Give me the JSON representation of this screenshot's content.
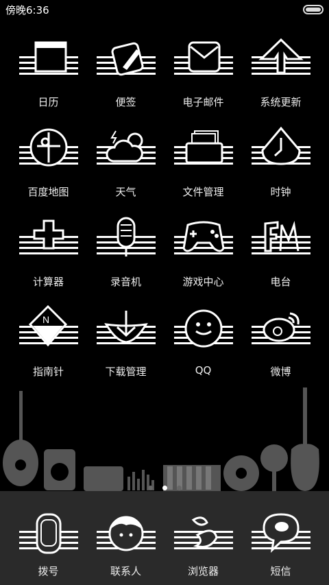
{
  "status": {
    "time": "傍晚6:36"
  },
  "apps": [
    {
      "label": "日历",
      "icon": "calendar-icon"
    },
    {
      "label": "便签",
      "icon": "notes-icon"
    },
    {
      "label": "电子邮件",
      "icon": "email-icon"
    },
    {
      "label": "系统更新",
      "icon": "system-update-icon"
    },
    {
      "label": "百度地图",
      "icon": "map-icon"
    },
    {
      "label": "天气",
      "icon": "weather-icon"
    },
    {
      "label": "文件管理",
      "icon": "file-manager-icon"
    },
    {
      "label": "时钟",
      "icon": "clock-icon"
    },
    {
      "label": "计算器",
      "icon": "calculator-icon"
    },
    {
      "label": "录音机",
      "icon": "recorder-icon"
    },
    {
      "label": "游戏中心",
      "icon": "gamepad-icon"
    },
    {
      "label": "电台",
      "icon": "radio-icon"
    },
    {
      "label": "指南针",
      "icon": "compass-icon"
    },
    {
      "label": "下载管理",
      "icon": "download-icon"
    },
    {
      "label": "QQ",
      "icon": "qq-penguin-icon"
    },
    {
      "label": "微博",
      "icon": "weibo-icon"
    }
  ],
  "pager": {
    "pages": 3,
    "current": 2
  },
  "dock": [
    {
      "label": "拨号",
      "icon": "phone-icon"
    },
    {
      "label": "联系人",
      "icon": "contacts-icon"
    },
    {
      "label": "浏览器",
      "icon": "browser-icon"
    },
    {
      "label": "短信",
      "icon": "messages-icon"
    }
  ],
  "icon_style": {
    "color": "#ffffff",
    "background": "#000000",
    "dock_background": "#2a2a2a"
  }
}
